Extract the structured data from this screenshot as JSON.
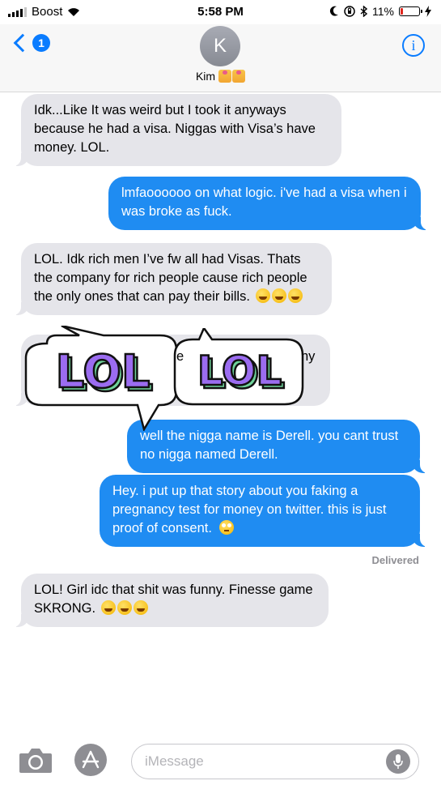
{
  "status_bar": {
    "carrier": "Boost",
    "time": "5:58 PM",
    "battery_percent": "11%",
    "icons": [
      "signal-icon",
      "wifi-icon",
      "moon-icon",
      "orientation-lock-icon",
      "bluetooth-icon",
      "battery-icon",
      "charging-icon"
    ]
  },
  "header": {
    "back_badge": "1",
    "avatar_initial": "K",
    "contact_name": "Kim",
    "info_label": "i"
  },
  "messages": [
    {
      "side": "in",
      "text": "Idk...Like It was weird but I took it anyways because he had a visa. Niggas with Visa’s have money. LOL."
    },
    {
      "side": "out",
      "text": "lmfaoooooo on what logic. i've had a visa when i was broke as fuck."
    },
    {
      "side": "in",
      "text": "LOL. Idk rich men I’ve fw all had Visas. Thats the company for rich people cause rich people the only ones that can pay their bills."
    },
    {
      "side": "in",
      "text": "e",
      "text_right": "ny"
    },
    {
      "side": "out",
      "text": "well the nigga name is Derell. you cant trust no nigga named Derell."
    },
    {
      "side": "out",
      "text": "Hey. i put up that story about you faking a pregnancy test for money on twitter. this is just proof of consent."
    },
    {
      "side": "in",
      "text": "LOL! Girl idc that shit was funny. Finesse game SKRONG."
    }
  ],
  "delivered_label": "Delivered",
  "stickers": [
    {
      "text": "LOL"
    },
    {
      "text": "LOL"
    }
  ],
  "input_bar": {
    "placeholder": "iMessage"
  },
  "colors": {
    "outgoing_bubble": "#1f8cf2",
    "incoming_bubble": "#e5e5ea",
    "accent": "#0a7cff",
    "sticker_fill": "#9b6cf0",
    "sticker_shadow": "#6fd39a"
  }
}
